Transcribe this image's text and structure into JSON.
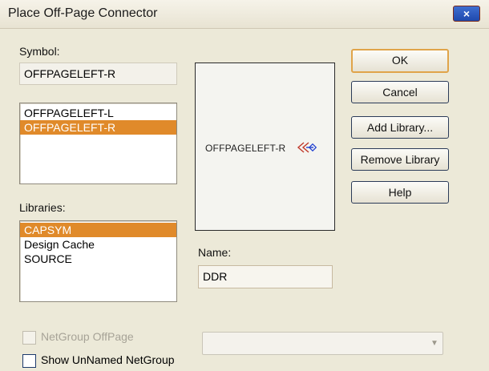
{
  "window": {
    "title": "Place Off-Page Connector",
    "close_icon": "×"
  },
  "symbol": {
    "label": "Symbol:",
    "value": "OFFPAGELEFT-R",
    "items": [
      "OFFPAGELEFT-L",
      "OFFPAGELEFT-R"
    ],
    "selected_index": 1
  },
  "libraries": {
    "label": "Libraries:",
    "items": [
      "CAPSYM",
      "Design Cache",
      "SOURCE"
    ],
    "selected_index": 0
  },
  "preview": {
    "text": "OFFPAGELEFT-R",
    "symbol_icon": "offpage-connector-left-icon"
  },
  "name": {
    "label": "Name:",
    "value": "DDR"
  },
  "buttons": {
    "ok": "OK",
    "cancel": "Cancel",
    "add_library": "Add Library...",
    "remove_library": "Remove Library",
    "help": "Help"
  },
  "checkboxes": {
    "netgroup_offpage": {
      "label": "NetGroup OffPage",
      "checked": false,
      "enabled": false
    },
    "show_unnamed": {
      "label": "Show UnNamed NetGroup",
      "checked": false,
      "enabled": true
    }
  },
  "netgroup_combo": {
    "value": "",
    "enabled": false
  },
  "colors": {
    "selection": "#e08a2a",
    "dialog_bg": "#ece9d8",
    "default_button_border": "#e0a44a"
  }
}
